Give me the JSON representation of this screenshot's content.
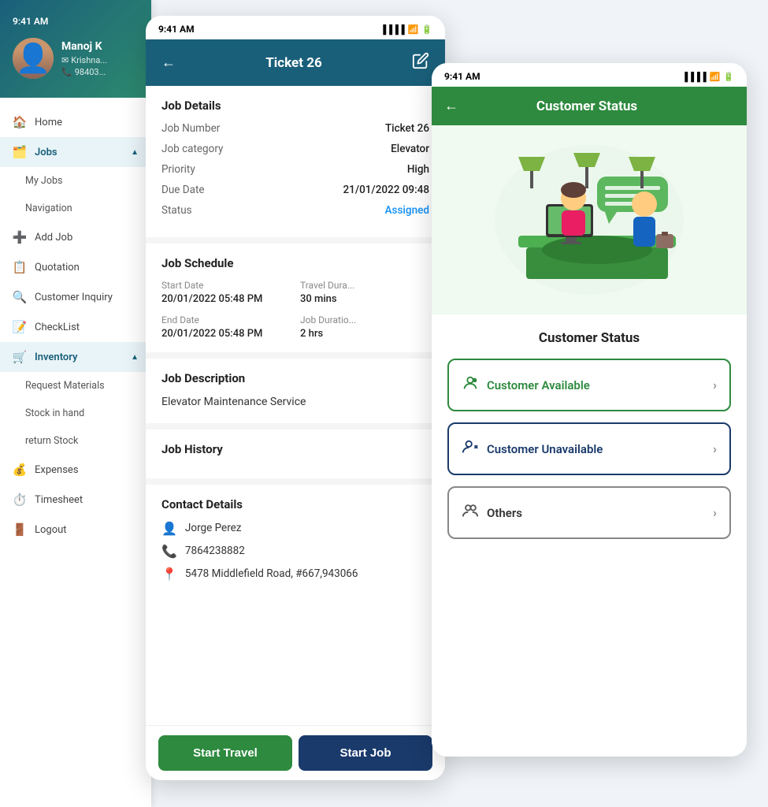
{
  "sidebar": {
    "time": "9:41 AM",
    "user": {
      "name": "Manoj K",
      "email": "Krishna...",
      "phone": "98403..."
    },
    "nav_items": [
      {
        "id": "home",
        "label": "Home",
        "icon": "🏠",
        "level": 0
      },
      {
        "id": "jobs",
        "label": "Jobs",
        "icon": "🗂️",
        "level": 0,
        "expanded": true
      },
      {
        "id": "my-jobs",
        "label": "My Jobs",
        "icon": "",
        "level": 1
      },
      {
        "id": "navigation",
        "label": "Navigation",
        "icon": "",
        "level": 1
      },
      {
        "id": "add-job",
        "label": "Add Job",
        "icon": "➕",
        "level": 0
      },
      {
        "id": "quotation",
        "label": "Quotation",
        "icon": "📋",
        "level": 0
      },
      {
        "id": "customer-inquiry",
        "label": "Customer Inquiry",
        "icon": "🔍",
        "level": 0
      },
      {
        "id": "checklist",
        "label": "CheckList",
        "icon": "📝",
        "level": 0
      },
      {
        "id": "inventory",
        "label": "Inventory",
        "icon": "🛒",
        "level": 0,
        "expanded": true
      },
      {
        "id": "request-materials",
        "label": "Request Materials",
        "icon": "",
        "level": 1
      },
      {
        "id": "stock-in-hand",
        "label": "Stock in hand",
        "icon": "",
        "level": 1
      },
      {
        "id": "return-stock",
        "label": "return Stock",
        "icon": "",
        "level": 1
      },
      {
        "id": "expenses",
        "label": "Expenses",
        "icon": "💰",
        "level": 0
      },
      {
        "id": "timesheet",
        "label": "Timesheet",
        "icon": "⏱️",
        "level": 0
      },
      {
        "id": "logout",
        "label": "Logout",
        "icon": "🚪",
        "level": 0
      }
    ]
  },
  "ticket": {
    "title": "Ticket 26",
    "status_bar_time": "9:41 AM",
    "sections": {
      "job_details": {
        "title": "Job Details",
        "fields": [
          {
            "label": "Job Number",
            "value": "Ticket 26"
          },
          {
            "label": "Job category",
            "value": "Elevator"
          },
          {
            "label": "Priority",
            "value": "High"
          },
          {
            "label": "Due Date",
            "value": "21/01/2022 09:48"
          },
          {
            "label": "Status",
            "value": "Assigned",
            "highlight": true
          }
        ]
      },
      "job_schedule": {
        "title": "Job Schedule",
        "start_date_label": "Start Date",
        "start_date_value": "20/01/2022 05:48 PM",
        "travel_duration_label": "Travel Dura...",
        "travel_duration_value": "30 mins",
        "end_date_label": "End Date",
        "end_date_value": "20/01/2022 05:48 PM",
        "job_duration_label": "Job Duratio...",
        "job_duration_value": "2 hrs"
      },
      "job_description": {
        "title": "Job Description",
        "text": "Elevator Maintenance Service"
      },
      "job_history": {
        "title": "Job History"
      },
      "contact_details": {
        "title": "Contact Details",
        "name": "Jorge Perez",
        "phone": "7864238882",
        "address": "5478 Middlefield Road, #667,943066"
      }
    },
    "buttons": {
      "start_travel": "Start Travel",
      "start_job": "Start Job"
    }
  },
  "customer_status": {
    "status_bar_time": "9:41 AM",
    "header_title": "Customer Status",
    "section_title": "Customer Status",
    "options": [
      {
        "id": "available",
        "label": "Customer Available",
        "type": "available"
      },
      {
        "id": "unavailable",
        "label": "Customer Unavailable",
        "type": "unavailable"
      },
      {
        "id": "others",
        "label": "Others",
        "type": "others"
      }
    ]
  },
  "icons": {
    "back_arrow": "←",
    "edit": "✎",
    "chevron_right": "›",
    "person_available": "👤",
    "person_unavailable": "👤✕",
    "person_others": "👥",
    "signal": "📶",
    "wifi": "📶",
    "battery": "🔋"
  }
}
